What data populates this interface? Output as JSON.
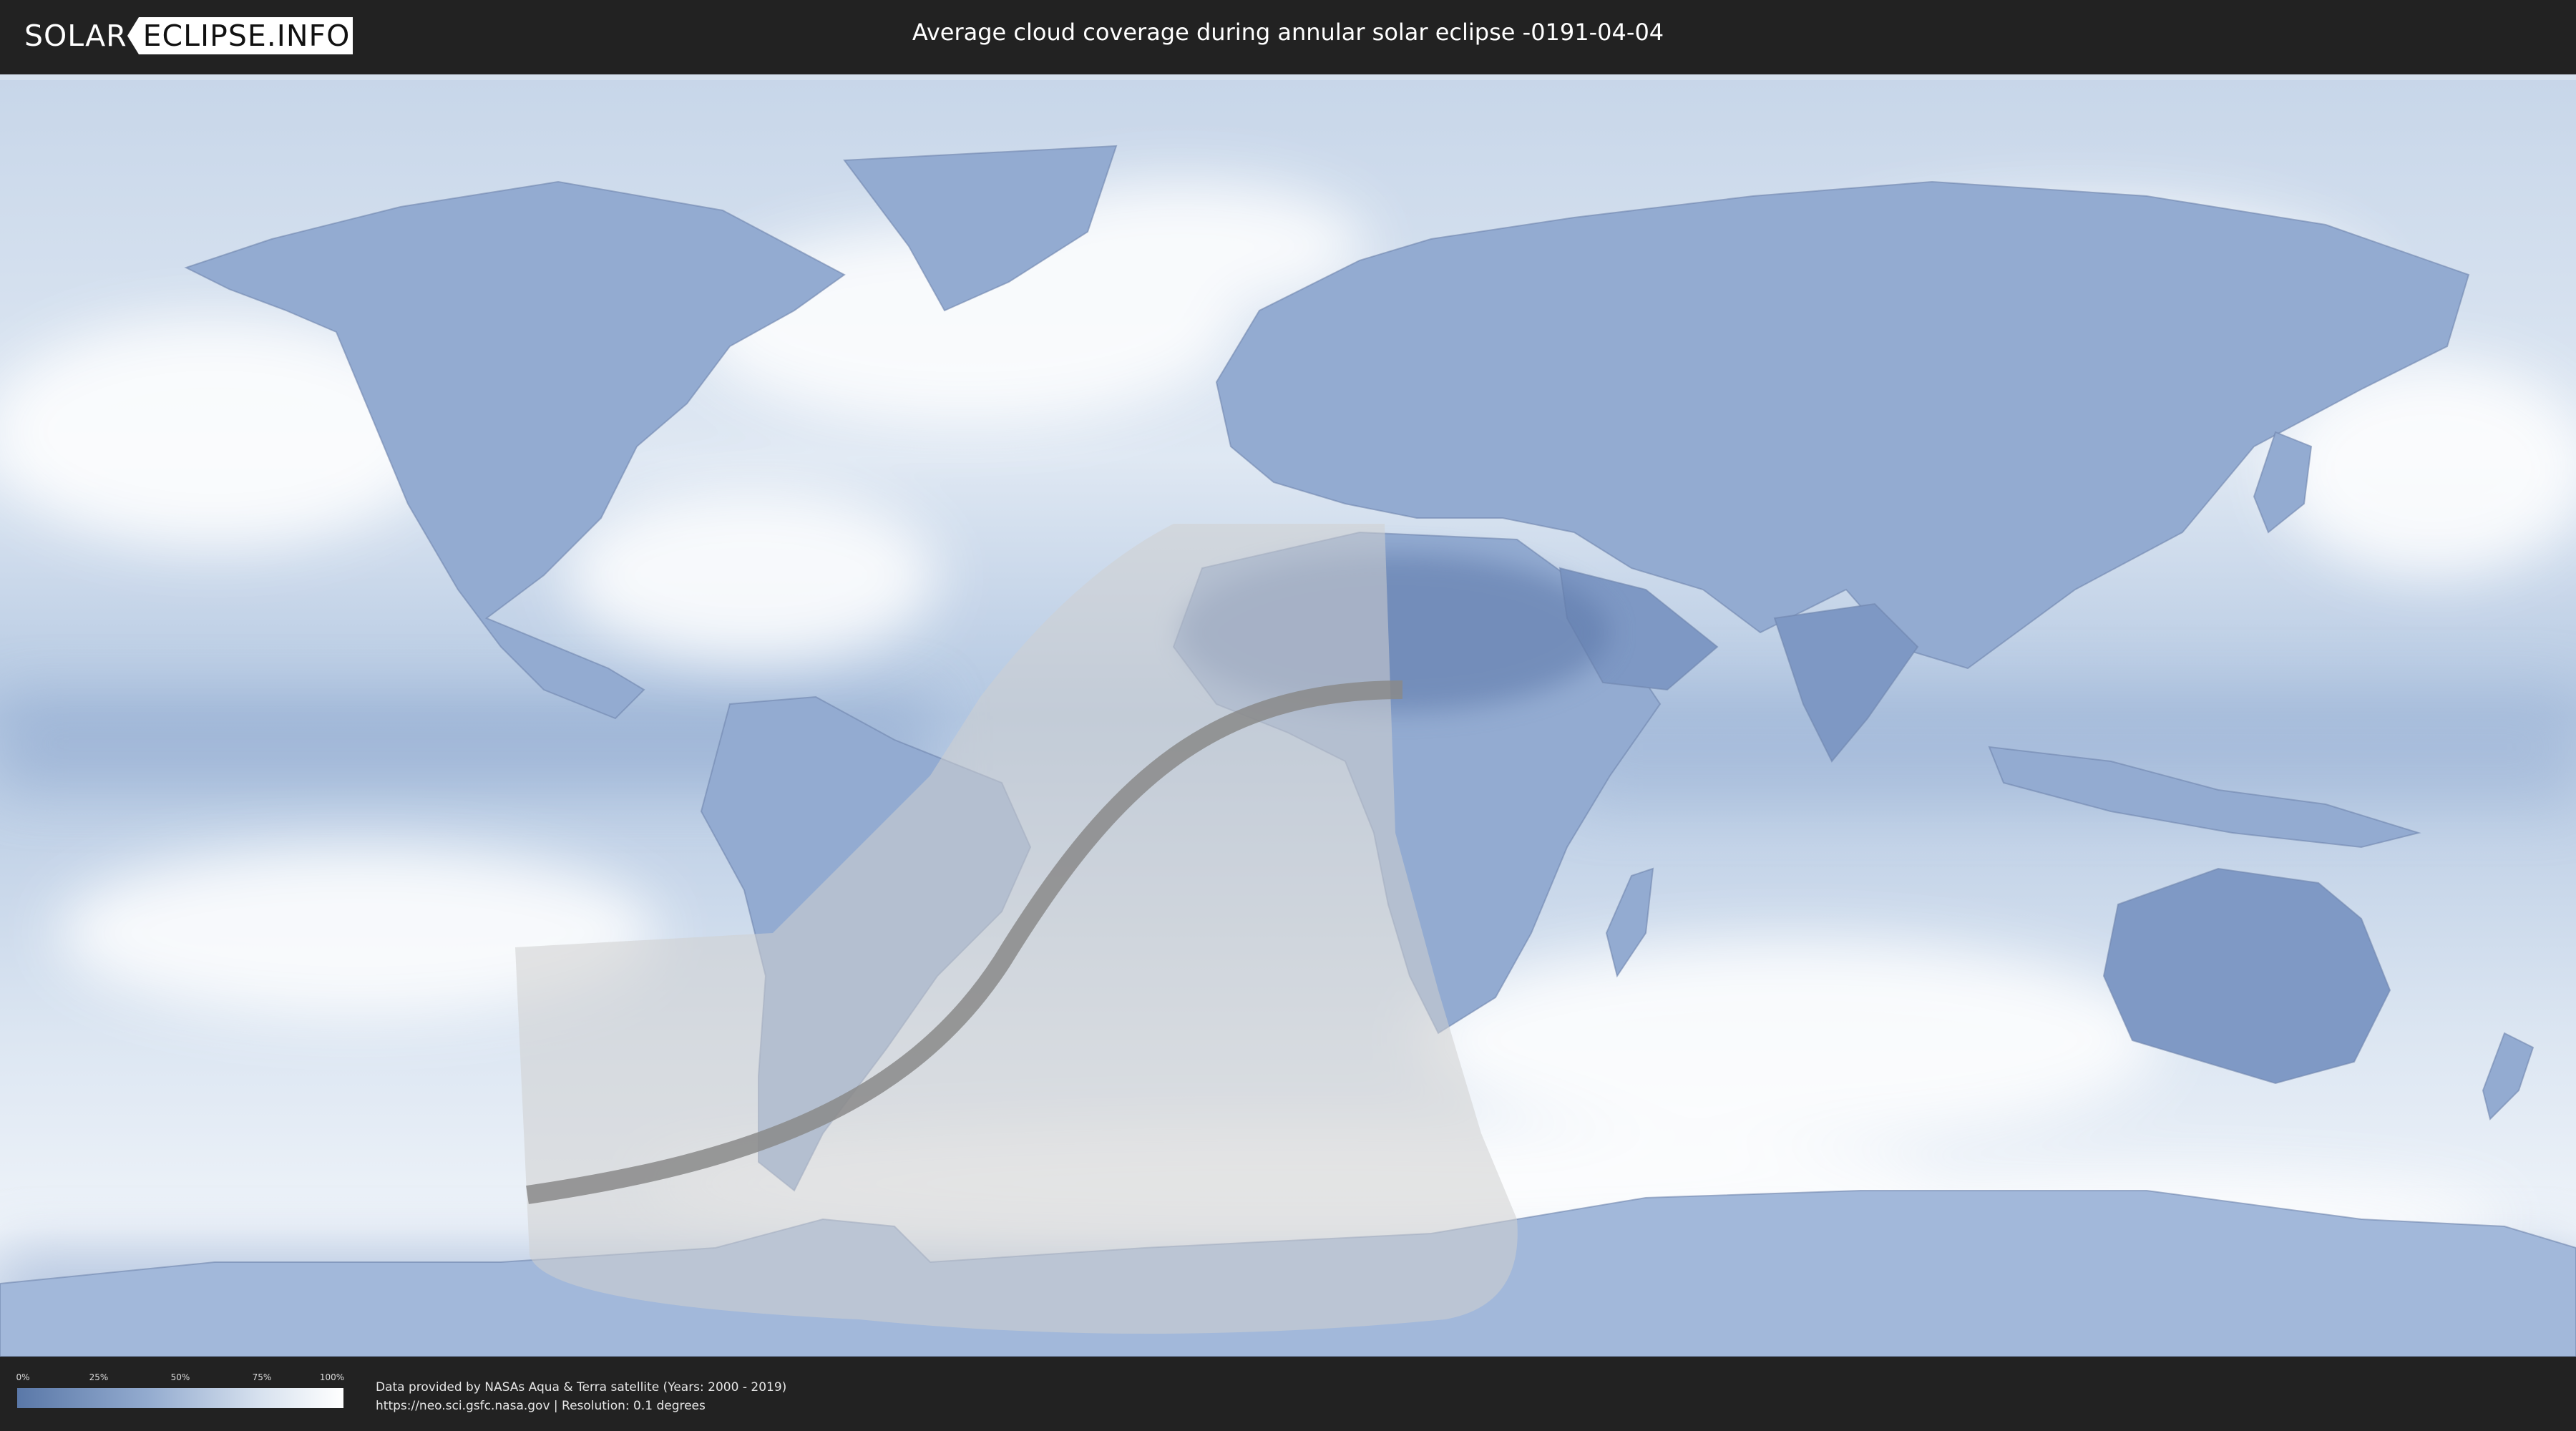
{
  "header": {
    "logo_left": "SOLAR",
    "logo_right": "ECLIPSE.INFO",
    "title": "Average cloud coverage during annular solar eclipse -0191-04-04"
  },
  "map": {
    "ocean_color": "#a8bfdc",
    "land_color": "#7b96c2",
    "cloud_color": "#ffffff",
    "eclipse_zone_color": "#d0d0d0",
    "central_path_color": "#8a8a8a"
  },
  "legend": {
    "ticks": [
      "0%",
      "25%",
      "50%",
      "75%",
      "100%"
    ]
  },
  "footer": {
    "credit_line1": "Data provided by NASAs Aqua & Terra satellite (Years: 2000 - 2019)",
    "credit_line2": "https://neo.sci.gsfc.nasa.gov | Resolution: 0.1 degrees"
  }
}
